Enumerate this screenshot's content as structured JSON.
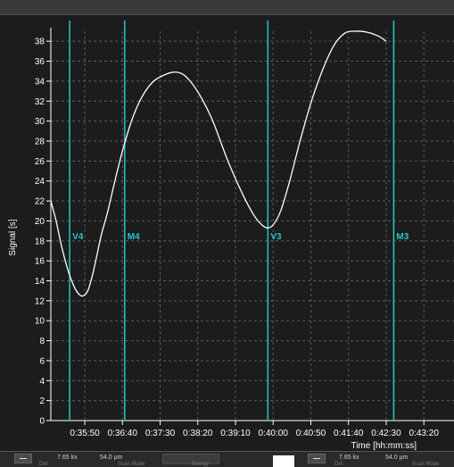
{
  "chart_data": {
    "type": "line",
    "title": "",
    "xlabel": "Time [hh:mm:ss]",
    "ylabel": "Signal [s]",
    "ylim": [
      0,
      39
    ],
    "yticks": [
      0,
      2,
      4,
      6,
      8,
      10,
      12,
      14,
      16,
      18,
      20,
      22,
      24,
      26,
      28,
      30,
      32,
      34,
      36,
      38
    ],
    "xlim_seconds": [
      2105,
      2640
    ],
    "xticks": [
      {
        "label": "0:35:50",
        "t": 2150
      },
      {
        "label": "0:36:40",
        "t": 2200
      },
      {
        "label": "0:37:30",
        "t": 2250
      },
      {
        "label": "0:38:20",
        "t": 2300
      },
      {
        "label": "0:39:10",
        "t": 2350
      },
      {
        "label": "0:40:00",
        "t": 2400
      },
      {
        "label": "0:40:50",
        "t": 2450
      },
      {
        "label": "0:41:40",
        "t": 2500
      },
      {
        "label": "0:42:30",
        "t": 2550
      },
      {
        "label": "0:43:20",
        "t": 2600
      }
    ],
    "grid": true,
    "series": [
      {
        "color": "#ffffff",
        "points": [
          [
            2105,
            22.0
          ],
          [
            2112,
            20.0
          ],
          [
            2120,
            17.2
          ],
          [
            2128,
            15.0
          ],
          [
            2136,
            13.4
          ],
          [
            2143,
            12.6
          ],
          [
            2148,
            12.5
          ],
          [
            2154,
            13.0
          ],
          [
            2160,
            14.5
          ],
          [
            2166,
            16.5
          ],
          [
            2172,
            18.6
          ],
          [
            2180,
            20.8
          ],
          [
            2190,
            24.0
          ],
          [
            2200,
            27.0
          ],
          [
            2212,
            30.0
          ],
          [
            2225,
            32.3
          ],
          [
            2240,
            33.9
          ],
          [
            2255,
            34.6
          ],
          [
            2268,
            34.9
          ],
          [
            2280,
            34.7
          ],
          [
            2292,
            33.8
          ],
          [
            2305,
            32.3
          ],
          [
            2320,
            30.0
          ],
          [
            2340,
            26.0
          ],
          [
            2360,
            22.6
          ],
          [
            2375,
            20.5
          ],
          [
            2385,
            19.6
          ],
          [
            2392,
            19.3
          ],
          [
            2400,
            19.6
          ],
          [
            2410,
            21.0
          ],
          [
            2422,
            24.0
          ],
          [
            2435,
            27.8
          ],
          [
            2450,
            31.8
          ],
          [
            2465,
            35.0
          ],
          [
            2480,
            37.5
          ],
          [
            2495,
            38.8
          ],
          [
            2510,
            39.0
          ],
          [
            2525,
            38.9
          ],
          [
            2540,
            38.5
          ],
          [
            2550,
            38.0
          ]
        ]
      }
    ],
    "markers": [
      {
        "label": "V4",
        "t": 2130,
        "color": "#22c7c7"
      },
      {
        "label": "M4",
        "t": 2203,
        "color": "#22c7c7"
      },
      {
        "label": "V3",
        "t": 2393,
        "color": "#22c7c7"
      },
      {
        "label": "M3",
        "t": 2560,
        "color": "#22c7c7"
      }
    ],
    "background": "#1c1c1c",
    "grid_color": "#5a5a5a",
    "text_color": "#ffffff"
  },
  "statusbar": {
    "left_mag": "7.65 kx",
    "left_pix": "54.0 µm",
    "left_sub1": "Det",
    "left_sub2": "Scan Mode",
    "left_sub3": "Energy",
    "right_mag": "7.65 kx",
    "right_pix": "54.0 µm",
    "right_sub1": "Det",
    "right_sub2": "Scan Mode"
  }
}
